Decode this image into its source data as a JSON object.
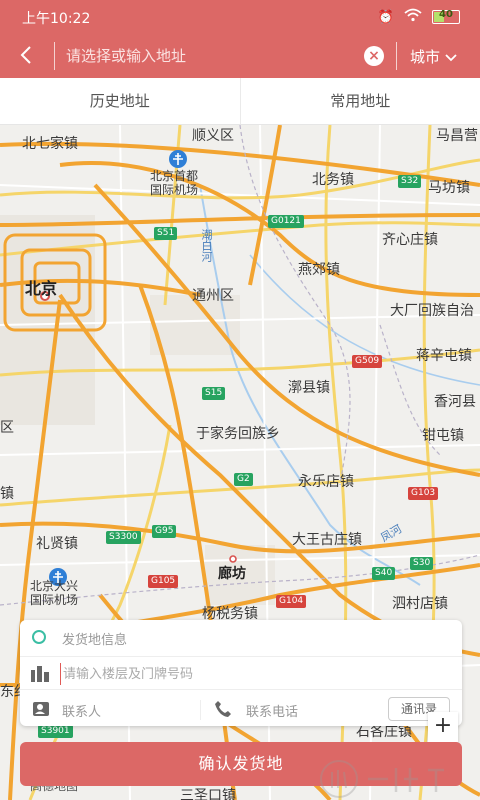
{
  "status_bar": {
    "time": "上午10:22",
    "battery": "40",
    "battery_level": 0.4
  },
  "header": {
    "search_placeholder": "请选择或输入地址",
    "city_label": "城市"
  },
  "tabs": [
    {
      "label": "历史地址"
    },
    {
      "label": "常用地址"
    }
  ],
  "map": {
    "labels": {
      "beijing": "北京",
      "beiqijia": "北七家镇",
      "shunyi": "顺义区",
      "mapo": "马昌营",
      "capital_airport": "北京首都\n国际机场",
      "beiwu": "北务镇",
      "mapojx": "马坊镇",
      "chaobaihe": "潮白河",
      "qixinzhuang": "齐心庄镇",
      "tongzhou": "通州区",
      "yanjiao": "燕郊镇",
      "dachang": "大厂回族自治",
      "xinzhuang": "蒋辛屯镇",
      "xiangxian": "漷县镇",
      "xianghe": "香河县",
      "yujiawu": "于家务回族乡",
      "qianshi": "钳屯镇",
      "yongle": "永乐店镇",
      "daxingcheng": "镇",
      "daxing_airport": "北京大兴\n国际机场",
      "lixian": "礼贤镇",
      "dawanggu": "大王古庄镇",
      "fenghe": "凤河",
      "langfang": "廊坊",
      "yangshuiwu": "杨税务镇",
      "shijiezhen": "泗村店镇",
      "anle": "东纪",
      "shige": "石各庄镇",
      "qiqu": "区",
      "yuqu": "三圣口镇"
    },
    "road_tags": {
      "s32": "S32",
      "s51": "S51",
      "g0121": "G0121",
      "g509": "G509",
      "s15": "S15",
      "g2": "G2",
      "g103": "G103",
      "s3300": "S3300",
      "g95": "G95",
      "s40": "S40",
      "s30": "S30",
      "g105": "G105",
      "g104": "G104",
      "s3901": "S3901"
    },
    "brand": "高德地图"
  },
  "form": {
    "origin_info": "发货地信息",
    "floor_placeholder": "请输入楼层及门牌号码",
    "contact_label": "联系人",
    "phone_label": "联系电话",
    "address_book": "通讯录"
  },
  "zoom_in": "+",
  "confirm_button": "确认发货地",
  "colors": {
    "primary": "#dc6866",
    "accent_teal": "#3bbea4",
    "road_orange": "#f2a431"
  }
}
